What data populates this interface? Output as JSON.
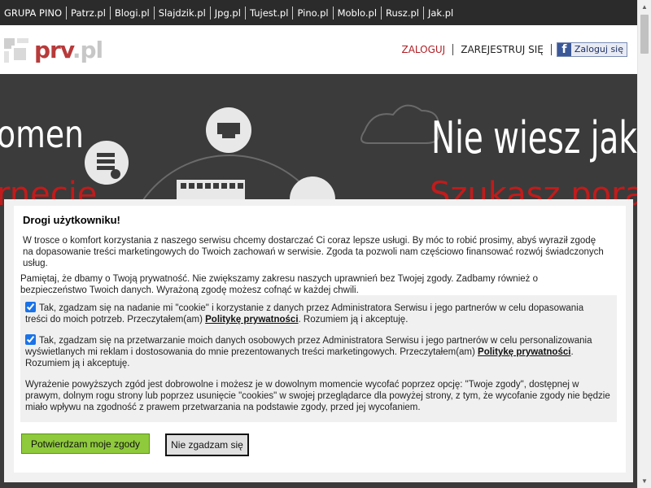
{
  "topbar": {
    "items": [
      "GRUPA PINO",
      "Patrz.pl",
      "Blogi.pl",
      "Slajdzik.pl",
      "Jpg.pl",
      "Tujest.pl",
      "Pino.pl",
      "Moblo.pl",
      "Rusz.pl",
      "Jak.pl"
    ]
  },
  "header": {
    "logo_main": "prv",
    "logo_suffix": ".pl",
    "login_label": "ZALOGUJ",
    "register_label": "ZAREJESTRUJ SIĘ",
    "fb_letter": "f",
    "fb_label": "Zaloguj się"
  },
  "hero": {
    "left_word": "omen",
    "right_word": "Nie wiesz jak",
    "left_red": "rnecie",
    "right_red": "Szukasz porady?"
  },
  "modal": {
    "title": "Drogi użytkowniku!",
    "intro": "W trosce o komfort korzystania z naszego serwisu chcemy dostarczać Ci coraz lepsze usługi. By móc to robić prosimy, abyś wyraził zgodę na dopasowanie treści marketingowych do Twoich zachowań w serwisie. Zgoda ta pozwoli nam częściowo finansować rozwój świadczonych usług.",
    "intro2": "Pamiętaj, że dbamy o Twoją prywatność. Nie zwiększamy zakresu naszych uprawnień bez Twojej zgody. Zadbamy również o bezpieczeństwo Twoich danych. Wyrażoną zgodę możesz cofnąć w każdej chwili.",
    "consent1_before": "Tak, zgadzam się na nadanie mi \"cookie\" i korzystanie z danych przez Administratora Serwisu i jego partnerów w celu dopasowania treści do moich potrzeb. Przeczytałem(am) ",
    "consent1_link": "Politykę prywatności",
    "consent1_after": ". Rozumiem ją i akceptuję.",
    "consent2_before": "Tak, zgadzam się na przetwarzanie moich danych osobowych przez Administratora Serwisu i jego partnerów w celu personalizowania wyświetlanych mi reklam i dostosowania do mnie prezentowanych treści marketingowych. Przeczytałem(am) ",
    "consent2_link": "Politykę prywatności",
    "consent2_after": ". Rozumiem ją i akceptuję.",
    "footnote": "Wyrażenie powyższych zgód jest dobrowolne i możesz je w dowolnym momencie wycofać poprzez opcję: \"Twoje zgody\", dostępnej w prawym, dolnym rogu strony lub poprzez usunięcie \"cookies\" w swojej przeglądarce dla powyżej strony, z tym, że wycofanie zgody nie będzie miało wpływu na zgodność z prawem przetwarzania na podstawie zgody, przed jej wycofaniem.",
    "accept_label": "Potwierdzam moje zgody",
    "reject_label": "Nie zgadzam się"
  },
  "colors": {
    "accent_red": "#b11e24",
    "accept_green": "#8fca3c",
    "topbar_bg": "#2b2b2b"
  }
}
